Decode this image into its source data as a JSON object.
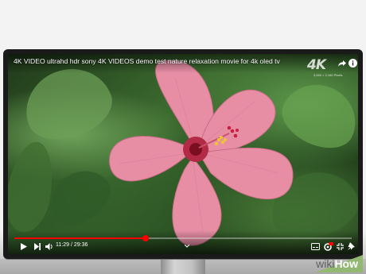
{
  "video": {
    "title": "4K VIDEO ultrahd hdr sony 4K VIDEOS demo test nature relaxation movie for 4k oled tv",
    "badge": "4K",
    "badge_subtitle": "3,840 × 2,160 Pixels",
    "time_display": "11:29 / 29:36",
    "progress_fraction": 0.39
  },
  "watermark": {
    "part1": "wiki",
    "part2": "How"
  },
  "icons": {
    "share": "share-icon",
    "info": "info-icon",
    "play": "play-icon",
    "next": "next-icon",
    "volume": "volume-icon",
    "chevron": "chevron-icon",
    "captions": "captions-icon",
    "settings": "settings-icon",
    "miniplayer": "miniplayer-icon",
    "pin": "pin-icon"
  },
  "colors": {
    "progress": "#ff0000",
    "flower": "#e58fa6",
    "wikihow_green": "#93b874"
  }
}
